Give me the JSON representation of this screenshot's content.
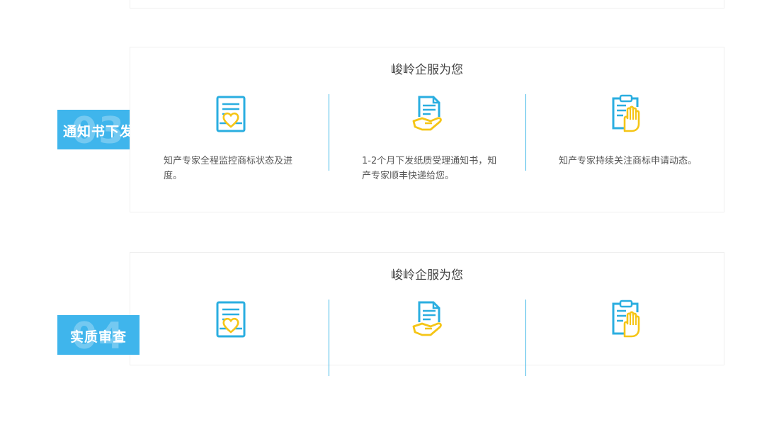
{
  "colors": {
    "accent": "#3fb5ec",
    "icon_blue": "#2aaee0",
    "icon_yellow": "#f5c516"
  },
  "sections": [
    {
      "step_number": "03",
      "step_label": "通知书下发",
      "card_title": "峻岭企服为您",
      "features": [
        {
          "icon": "certificate-heart-icon",
          "text": "知产专家全程监控商标状态及进度。"
        },
        {
          "icon": "hand-document-icon",
          "text": "1-2个月下发纸质受理通知书，知产专家顺丰快递给您。"
        },
        {
          "icon": "clipboard-hand-icon",
          "text": "知产专家持续关注商标申请动态。"
        }
      ]
    },
    {
      "step_number": "04",
      "step_label": "实质审查",
      "card_title": "峻岭企服为您",
      "features": [
        {
          "icon": "certificate-heart-icon",
          "text": ""
        },
        {
          "icon": "hand-document-icon",
          "text": ""
        },
        {
          "icon": "clipboard-hand-icon",
          "text": ""
        }
      ]
    }
  ]
}
